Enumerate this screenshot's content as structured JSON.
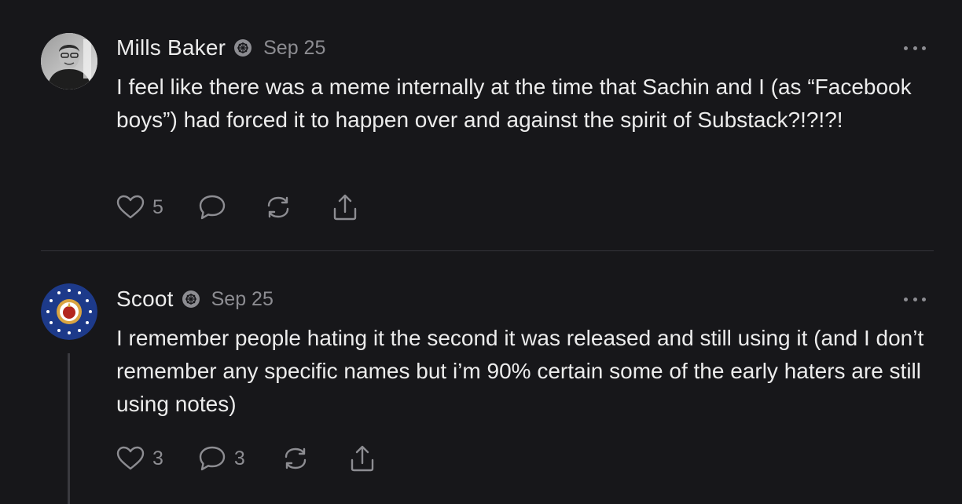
{
  "comments": [
    {
      "author": "Mills Baker",
      "date": "Sep 25",
      "body": "I feel like there was a meme internally at the time that Sachin and I (as “Facebook boys”) had forced it to happen over and against the spirit of Substack?!?!?!",
      "likes": "5",
      "replies": "",
      "avatar": "avatar-photo",
      "badge": "verified-badge-icon"
    },
    {
      "author": "Scoot",
      "date": "Sep 25",
      "body": "I remember people hating it the second it was released and still using it (and I don’t remember any specific names but i’m 90% certain some of the early haters are still using notes)",
      "likes": "3",
      "replies": "3",
      "avatar": "avatar-emblem",
      "badge": "verified-badge-icon"
    }
  ],
  "icons": {
    "like": "heart-icon",
    "reply": "comment-icon",
    "restack": "restack-icon",
    "share": "share-icon",
    "more": "more-options-icon"
  },
  "colors": {
    "background": "#17171a",
    "text": "#ececec",
    "muted": "#8d8d92",
    "divider": "#35353a"
  }
}
